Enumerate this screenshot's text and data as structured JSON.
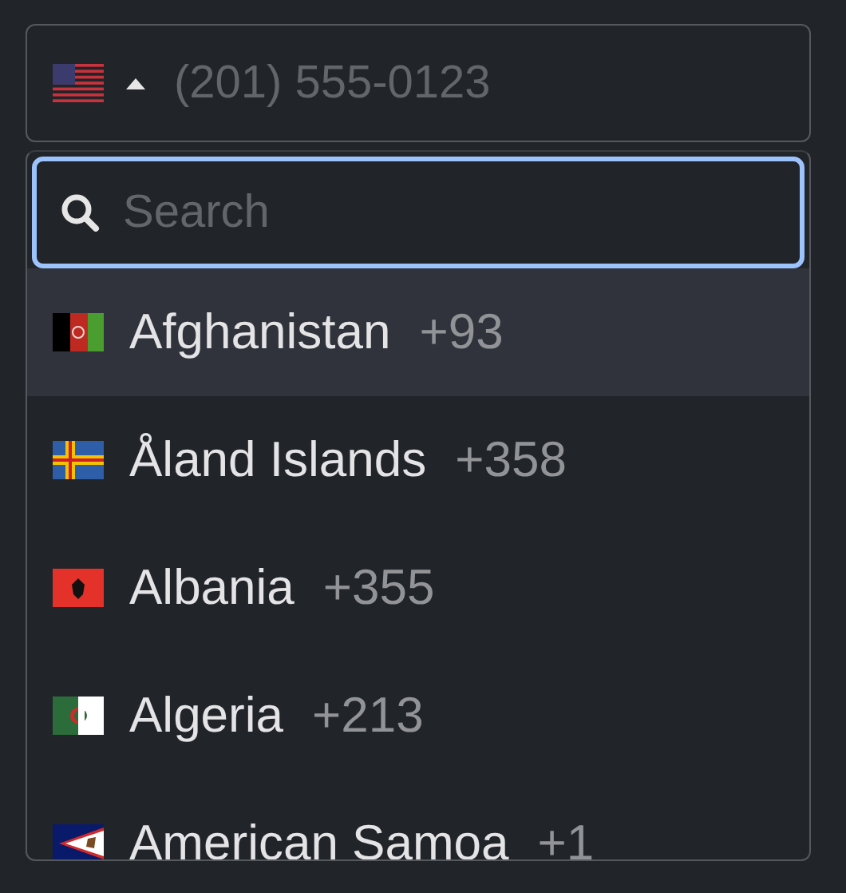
{
  "phone_field": {
    "country": {
      "kind": "us",
      "expanded": true
    },
    "placeholder": "(201) 555-0123"
  },
  "dropdown": {
    "search": {
      "placeholder": "Search"
    },
    "countries": [
      {
        "kind": "af",
        "name": "Afghanistan",
        "code": "+93",
        "selected": true
      },
      {
        "kind": "ax",
        "name": "Åland Islands",
        "code": "+358",
        "selected": false
      },
      {
        "kind": "al",
        "name": "Albania",
        "code": "+355",
        "selected": false
      },
      {
        "kind": "dz",
        "name": "Algeria",
        "code": "+213",
        "selected": false
      },
      {
        "kind": "as",
        "name": "American Samoa",
        "code": "+1",
        "selected": false
      }
    ]
  }
}
